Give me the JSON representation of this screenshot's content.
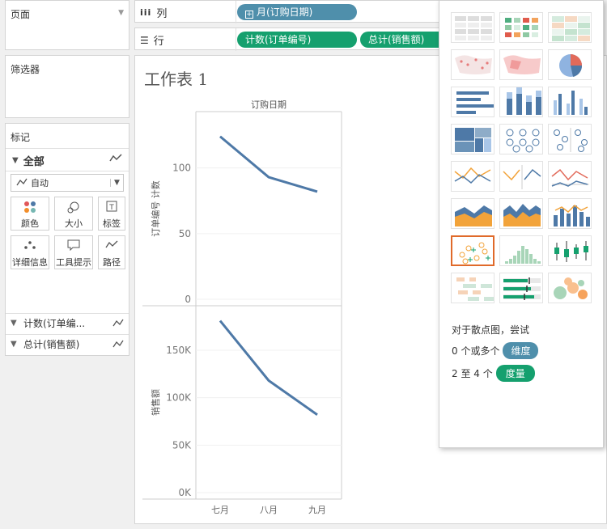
{
  "left": {
    "pages_title": "页面",
    "filters_title": "筛选器",
    "marks_title": "标记",
    "all_label": "全部",
    "mark_type": "自动",
    "mark_buttons": [
      {
        "label": "颜色"
      },
      {
        "label": "大小"
      },
      {
        "label": "标签"
      },
      {
        "label": "详细信息"
      },
      {
        "label": "工具提示"
      },
      {
        "label": "路径"
      }
    ],
    "measure_rows": [
      "计数(订单编...",
      "总计(销售额)"
    ]
  },
  "shelves": {
    "columns_label": "列",
    "rows_label": "行",
    "columns_pills": [
      "月(订购日期)"
    ],
    "rows_pills": [
      "计数(订单编号)",
      "总计(销售额)"
    ]
  },
  "worksheet": {
    "title": "工作表 1"
  },
  "showme": {
    "hint_title": "对于散点图，尝试",
    "dim_prefix": "0 个或多个",
    "dim_pill": "维度",
    "meas_prefix": "2 至 4 个",
    "meas_pill": "度量",
    "colors": {
      "dimension": "#4f8fab",
      "measure": "#15a06e",
      "selected": "#e06a2a"
    }
  },
  "chart_data": [
    {
      "type": "line",
      "title": "订购日期",
      "categories": [
        "七月",
        "八月",
        "九月"
      ],
      "ylabel": "订单编号 计数",
      "ylim": [
        0,
        138
      ],
      "yticks": [
        {
          "v": 0,
          "t": "0"
        },
        {
          "v": 50,
          "t": "50"
        },
        {
          "v": 100,
          "t": "100"
        }
      ],
      "values": [
        124,
        93,
        82
      ],
      "color": "#4e79a7"
    },
    {
      "type": "line",
      "categories": [
        "七月",
        "八月",
        "九月"
      ],
      "ylabel": "销售额",
      "ylim": [
        0,
        190000
      ],
      "yticks": [
        {
          "v": 0,
          "t": "0K"
        },
        {
          "v": 50000,
          "t": "50K"
        },
        {
          "v": 100000,
          "t": "100K"
        },
        {
          "v": 150000,
          "t": "150K"
        }
      ],
      "values": [
        181000,
        118000,
        82000
      ],
      "color": "#4e79a7"
    }
  ]
}
